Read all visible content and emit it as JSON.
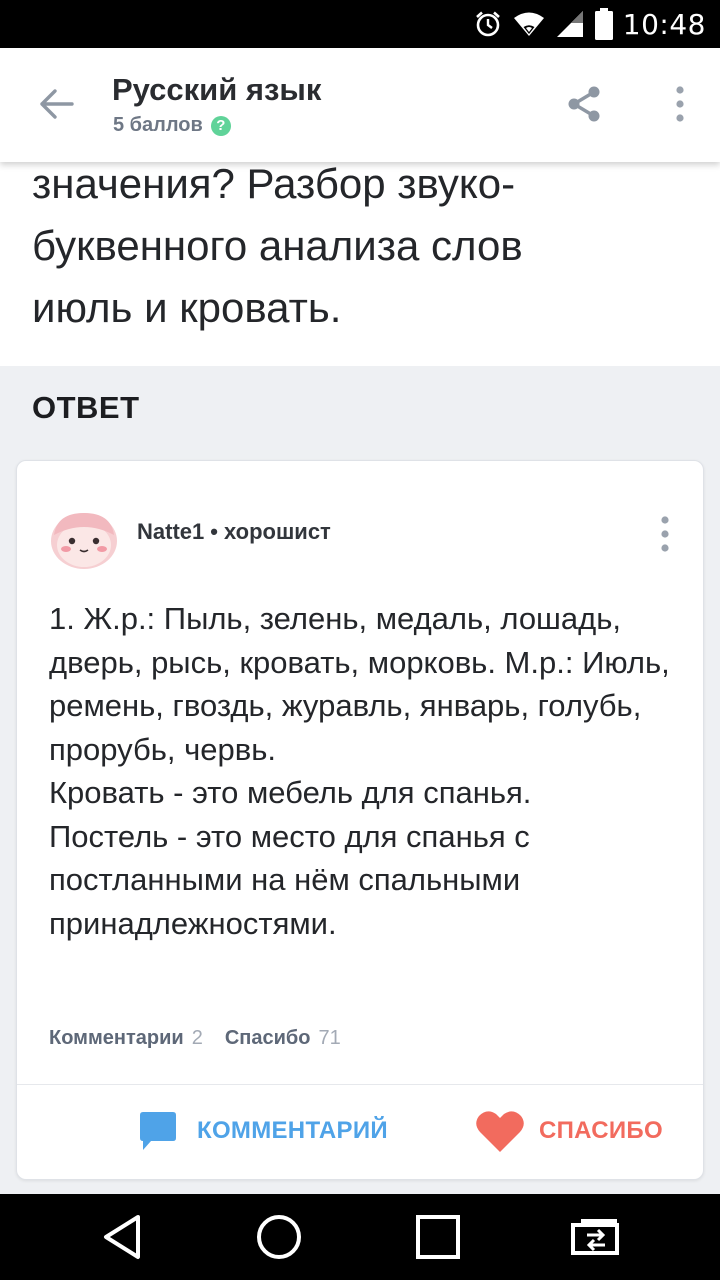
{
  "status_bar": {
    "time": "10:48"
  },
  "app_bar": {
    "subject": "Русский язык",
    "points": "5 баллов",
    "help_badge": "?"
  },
  "question": {
    "text": "значения? Разбор звуко-\nбуквенного анализа слов\nиюль и кровать."
  },
  "answer_heading": "ОТВЕТ",
  "answer": {
    "author": "Natte1",
    "separator": "•",
    "rank": "хорошист",
    "text": "1. Ж.р.: Пыль, зелень, медаль, лошадь, дверь, рысь, кровать, морковь. М.р.: Июль, ремень, гвоздь, журавль, январь, голубь, прорубь, червь.\nКровать - это мебель для спанья.\nПостель - это место для спанья с постланными на нём спальными принадлежностями.",
    "comments_label": "Комментарии",
    "comments_count": "2",
    "thanks_label": "Спасибо",
    "thanks_count": "71",
    "comment_button_label": "КОММЕНТАРИЙ",
    "thanks_button_label": "СПАСИБО"
  },
  "colors": {
    "accent_blue": "#4fa3e8",
    "accent_red": "#f26b5e",
    "help_green": "#60d399"
  },
  "icons": [
    "alarm-icon",
    "wifi-icon",
    "signal-icon",
    "battery-icon",
    "back-arrow-icon",
    "share-icon",
    "more-vert-icon",
    "avatar-image",
    "comment-bubble-icon",
    "heart-icon",
    "nav-back-icon",
    "nav-home-icon",
    "nav-recents-icon",
    "nav-switch-icon"
  ]
}
